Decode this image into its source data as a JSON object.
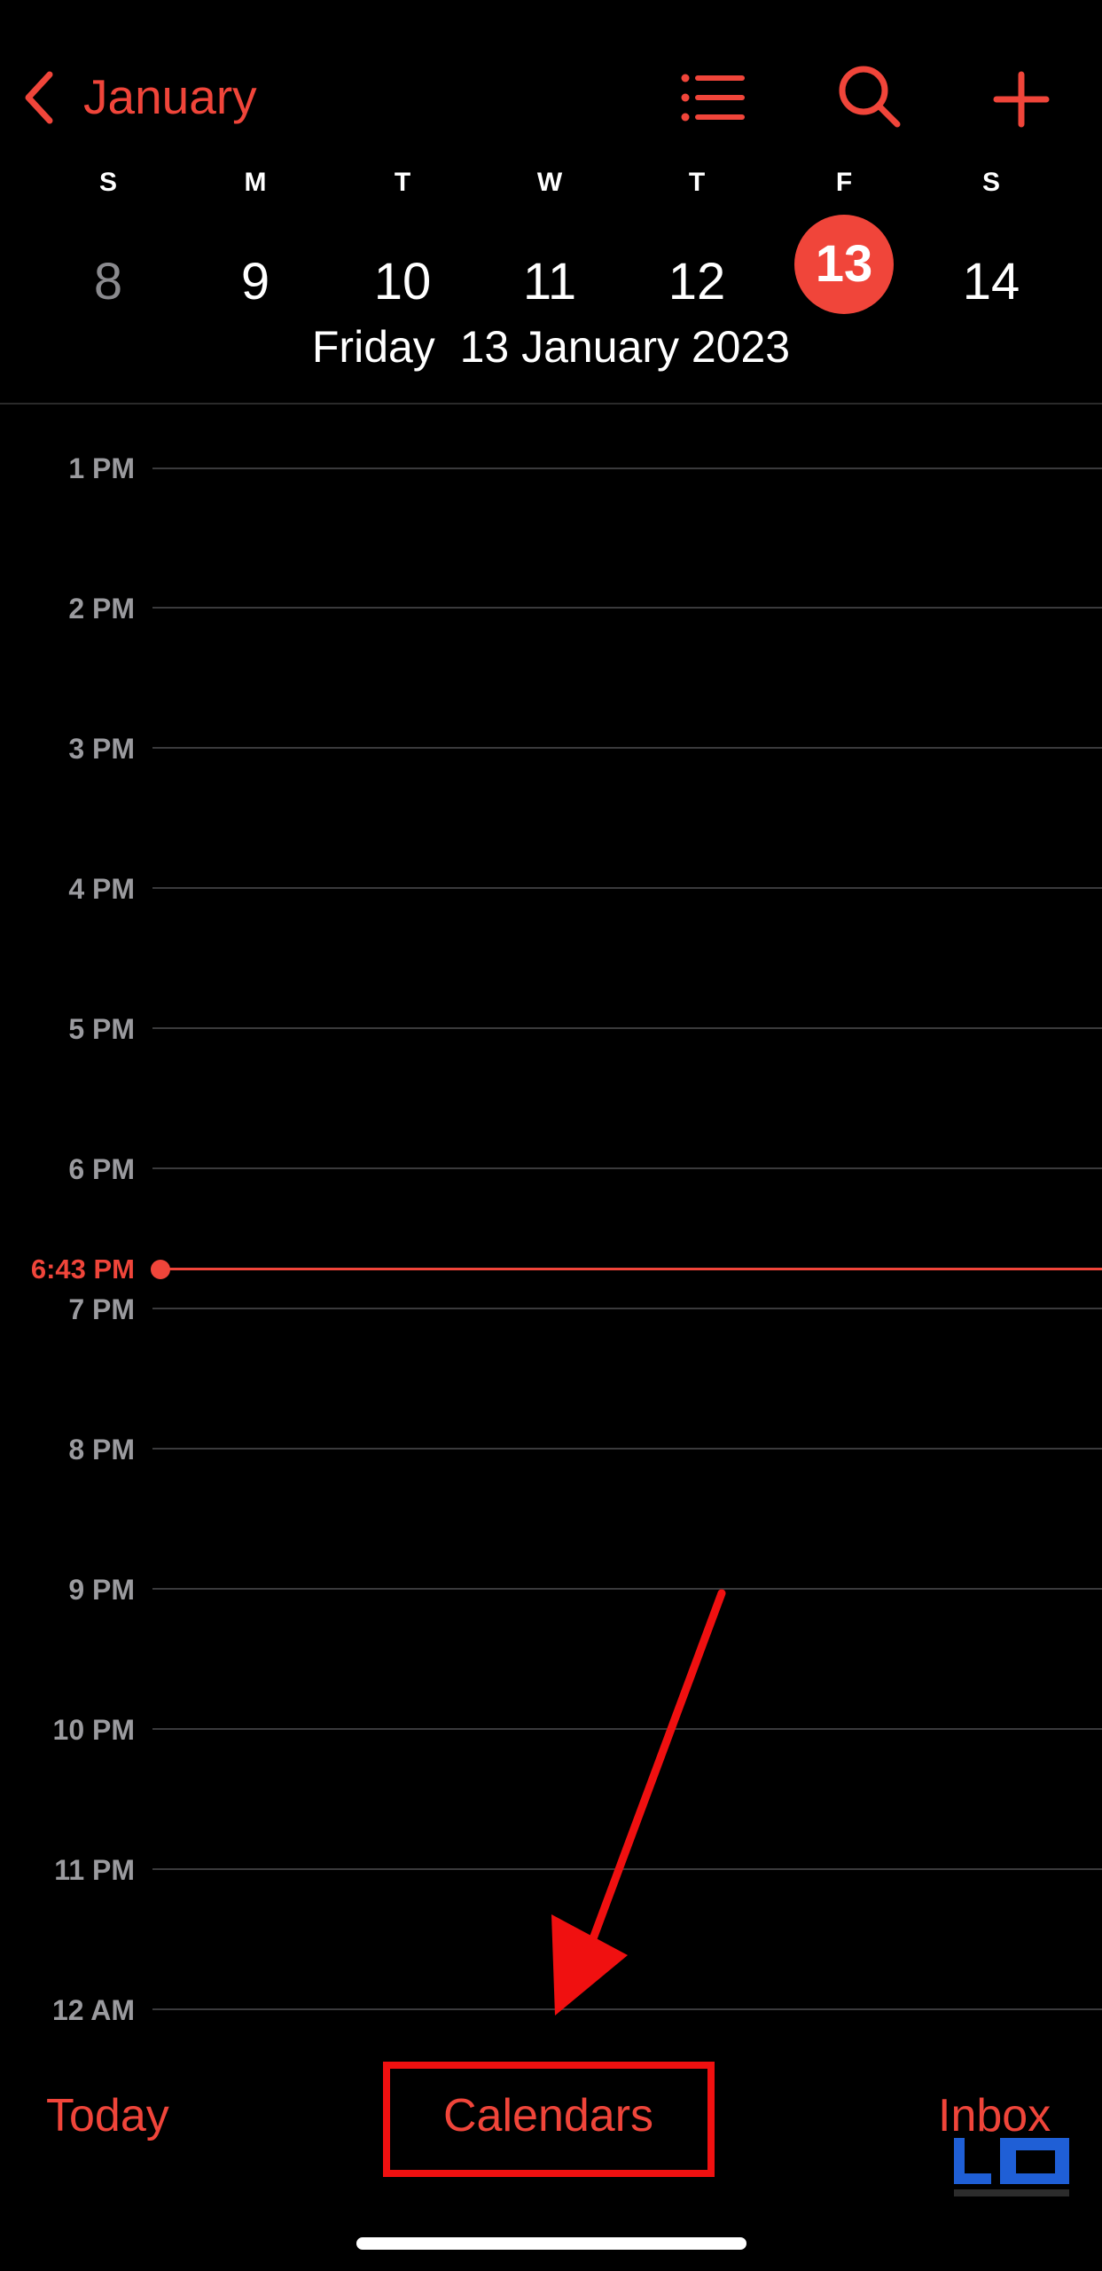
{
  "nav": {
    "back_label": "January"
  },
  "week": {
    "days": [
      {
        "dow": "S",
        "num": "8"
      },
      {
        "dow": "M",
        "num": "9"
      },
      {
        "dow": "T",
        "num": "10"
      },
      {
        "dow": "W",
        "num": "11"
      },
      {
        "dow": "T",
        "num": "12"
      },
      {
        "dow": "F",
        "num": "13"
      },
      {
        "dow": "S",
        "num": "14"
      }
    ],
    "selected_title": "Friday  13 January 2023"
  },
  "timeline": {
    "hours": [
      "1 PM",
      "2 PM",
      "3 PM",
      "4 PM",
      "5 PM",
      "6 PM",
      "7 PM",
      "8 PM",
      "9 PM",
      "10 PM",
      "11 PM",
      "12 AM"
    ],
    "current_time": "6:43 PM"
  },
  "toolbar": {
    "today_label": "Today",
    "calendars_label": "Calendars",
    "inbox_label": "Inbox"
  },
  "icons": {
    "back": "chevron-left-icon",
    "list": "list-icon",
    "search": "search-icon",
    "add": "plus-icon"
  },
  "colors": {
    "accent": "#f0453a",
    "background": "#000000",
    "annotation": "#f01010"
  }
}
